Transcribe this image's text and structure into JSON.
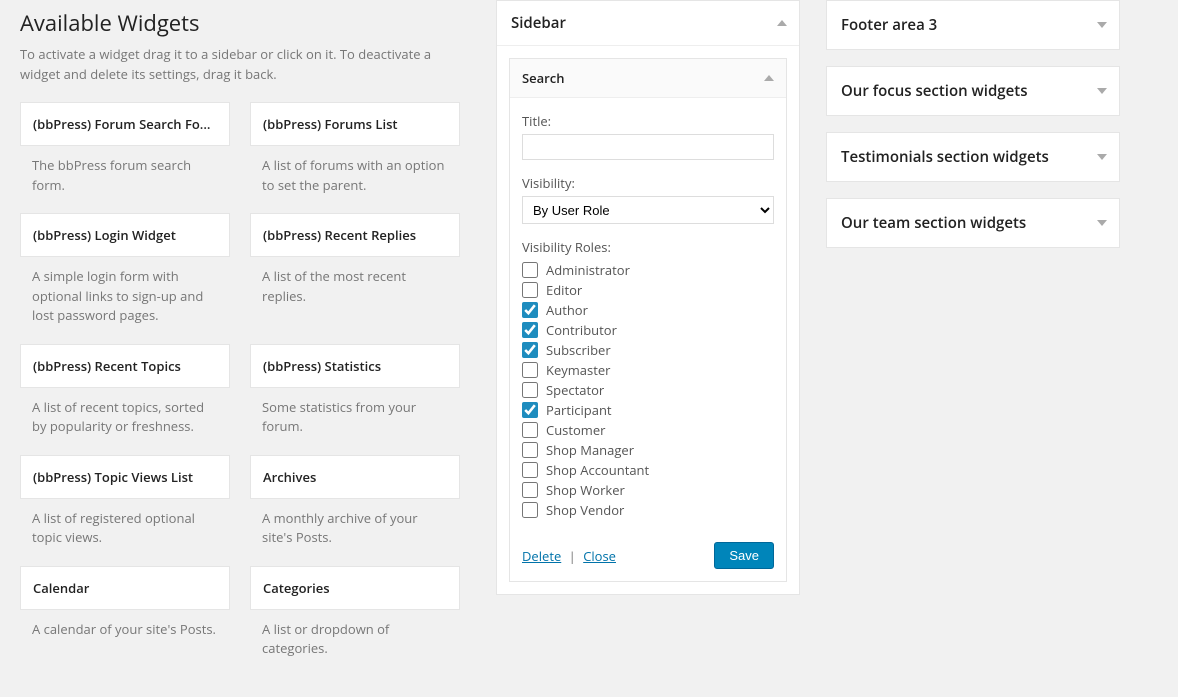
{
  "available": {
    "heading": "Available Widgets",
    "description": "To activate a widget drag it to a sidebar or click on it. To deactivate a widget and delete its settings, drag it back.",
    "widgets": [
      {
        "title": "(bbPress) Forum Search Fo...",
        "desc": "The bbPress forum search form."
      },
      {
        "title": "(bbPress) Forums List",
        "desc": "A list of forums with an option to set the parent."
      },
      {
        "title": "(bbPress) Login Widget",
        "desc": "A simple login form with optional links to sign-up and lost password pages."
      },
      {
        "title": "(bbPress) Recent Replies",
        "desc": "A list of the most recent replies."
      },
      {
        "title": "(bbPress) Recent Topics",
        "desc": "A list of recent topics, sorted by popularity or freshness."
      },
      {
        "title": "(bbPress) Statistics",
        "desc": "Some statistics from your forum."
      },
      {
        "title": "(bbPress) Topic Views List",
        "desc": "A list of registered optional topic views."
      },
      {
        "title": "Archives",
        "desc": "A monthly archive of your site's Posts."
      },
      {
        "title": "Calendar",
        "desc": "A calendar of your site's Posts."
      },
      {
        "title": "Categories",
        "desc": "A list or dropdown of categories."
      }
    ]
  },
  "sidebarPanel": {
    "title": "Sidebar",
    "widget": {
      "name": "Search",
      "titleLabel": "Title:",
      "titleValue": "",
      "visibilityLabel": "Visibility:",
      "visibilityValue": "By User Role",
      "rolesLabel": "Visibility Roles:",
      "roles": [
        {
          "label": "Administrator",
          "checked": false
        },
        {
          "label": "Editor",
          "checked": false
        },
        {
          "label": "Author",
          "checked": true
        },
        {
          "label": "Contributor",
          "checked": true
        },
        {
          "label": "Subscriber",
          "checked": true
        },
        {
          "label": "Keymaster",
          "checked": false
        },
        {
          "label": "Spectator",
          "checked": false
        },
        {
          "label": "Participant",
          "checked": true
        },
        {
          "label": "Customer",
          "checked": false
        },
        {
          "label": "Shop Manager",
          "checked": false
        },
        {
          "label": "Shop Accountant",
          "checked": false
        },
        {
          "label": "Shop Worker",
          "checked": false
        },
        {
          "label": "Shop Vendor",
          "checked": false
        }
      ],
      "deleteLabel": "Delete",
      "closeLabel": "Close",
      "saveLabel": "Save"
    }
  },
  "rightPanels": [
    {
      "title": "Footer area 3"
    },
    {
      "title": "Our focus section widgets"
    },
    {
      "title": "Testimonials section widgets"
    },
    {
      "title": "Our team section widgets"
    }
  ]
}
